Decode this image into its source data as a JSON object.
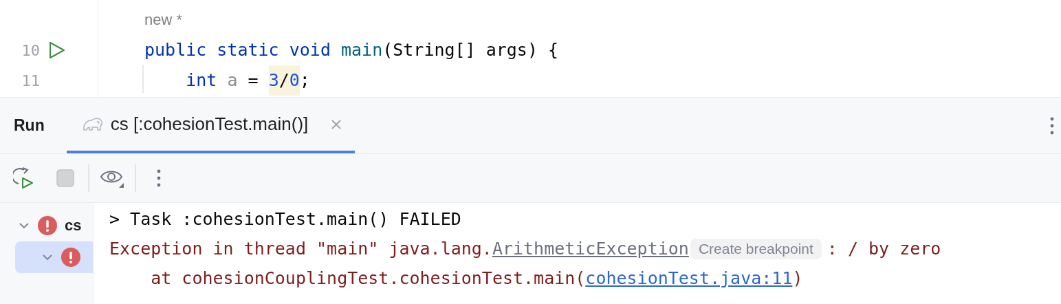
{
  "editor": {
    "inlay_hint": "new *",
    "lines": [
      {
        "number": "10",
        "run_gutter": true,
        "tokens": [
          {
            "kind": "keyword",
            "text": "public",
            "highlighted": false
          },
          {
            "kind": "keyword",
            "text": " static",
            "highlighted": false
          },
          {
            "kind": "keyword",
            "text": " void",
            "highlighted": false
          },
          {
            "kind": "method",
            "text": " main",
            "highlighted": false
          },
          {
            "kind": "plain",
            "text": "(String[] args) {",
            "highlighted": false
          }
        ]
      },
      {
        "number": "11",
        "run_gutter": false,
        "tokens": [
          {
            "kind": "keyword",
            "text": "    int",
            "highlighted": false
          },
          {
            "kind": "unused",
            "text": " a",
            "highlighted": false
          },
          {
            "kind": "plain",
            "text": " = ",
            "highlighted": false
          },
          {
            "kind": "number",
            "text": "3",
            "highlighted": true
          },
          {
            "kind": "plain",
            "text": "/",
            "highlighted": true
          },
          {
            "kind": "number",
            "text": "0",
            "highlighted": true
          },
          {
            "kind": "plain",
            "text": ";",
            "highlighted": false
          }
        ]
      }
    ]
  },
  "run_panel": {
    "title": "Run",
    "tabs": [
      {
        "label": "cs [:cohesionTest.main()]",
        "selected": true
      }
    ],
    "tree": [
      {
        "label": "cs",
        "failed": true,
        "expanded": true,
        "selected": false,
        "children": [
          {
            "failed": true,
            "expanded": true,
            "selected": true
          }
        ]
      }
    ],
    "console": [
      {
        "kind": "output",
        "segments": [
          {
            "kind": "text",
            "text": "> Task :cohesionTest.main() FAILED"
          }
        ]
      },
      {
        "kind": "error",
        "segments": [
          {
            "kind": "text",
            "text": "Exception in thread \"main\" java.lang."
          },
          {
            "kind": "class_link",
            "text": "ArithmeticException"
          },
          {
            "kind": "chip",
            "text": "Create breakpoint"
          },
          {
            "kind": "text",
            "text": ": / by zero"
          }
        ]
      },
      {
        "kind": "error",
        "segments": [
          {
            "kind": "text",
            "text": "    at cohesionCouplingTest.cohesionTest.main("
          },
          {
            "kind": "file_link",
            "text": "cohesionTest.java:11"
          },
          {
            "kind": "text",
            "text": ")"
          }
        ]
      }
    ]
  }
}
